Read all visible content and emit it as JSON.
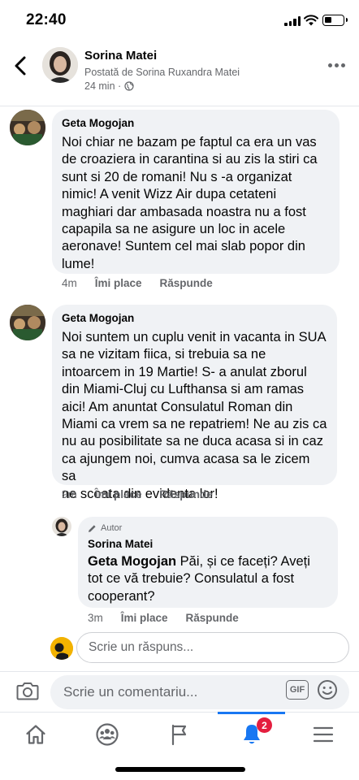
{
  "status_bar": {
    "time": "22:40"
  },
  "header": {
    "name": "Sorina Matei",
    "subtitle": "Postată de Sorina Ruxandra Matei",
    "time": "24 min ·"
  },
  "comments": [
    {
      "author": "Geta Mogojan",
      "text": "Noi chiar ne bazam pe faptul ca era un vas\nde croaziera in carantina si au zis la stiri ca\nsunt si 20 de romani! Nu s -a organizat\nnimic! A venit Wizz Air dupa cetateni\nmaghiari dar ambasada noastra nu a fost\ncapapila sa ne asigure un loc  in acele\naeronave! Suntem cel mai slab popor din\nlume!",
      "time": "4m",
      "like": "Îmi place",
      "reply": "Răspunde"
    },
    {
      "author": "Geta Mogojan",
      "text": "Noi suntem un cuplu venit in vacanta in SUA\nsa ne vizitam fiica, si trebuia sa ne\nintoarcem in 19 Martie! S- a anulat zborul\ndin Miami-Cluj cu Lufthansa si am ramas\naici! Am anuntat Consulatul Roman din\nMiami ca vrem sa ne repatriem! Ne au zis ca\nnu au posibilitate sa ne duca acasa si in caz\nca ajungem noi, cumva acasa sa le zicem sa\nne scoata din evidenta lor!",
      "time": "9m",
      "like": "Îmi place",
      "reply": "Răspunde"
    }
  ],
  "reply": {
    "badge": "Autor",
    "author": "Sorina Matei",
    "mention": "Geta Mogojan",
    "text": " Păi, și ce faceți? Aveți tot ce vă trebuie? Consulatul a fost cooperant?",
    "time": "3m",
    "like": "Îmi place",
    "reply": "Răspunde"
  },
  "reply_input": {
    "placeholder": "Scrie un răspuns..."
  },
  "comment_input": {
    "placeholder": "Scrie un comentariu...",
    "gif_label": "GIF"
  },
  "nav": {
    "items": [
      "home-icon",
      "groups-icon",
      "pages-flag-icon",
      "notifications-bell-icon",
      "menu-icon"
    ],
    "active": "notifications-bell-icon",
    "notification_badge": "2"
  },
  "colors": {
    "accent": "#1877f2",
    "badge": "#e41e3f",
    "bubble": "#f0f2f5",
    "secondary_text": "#65676b"
  }
}
